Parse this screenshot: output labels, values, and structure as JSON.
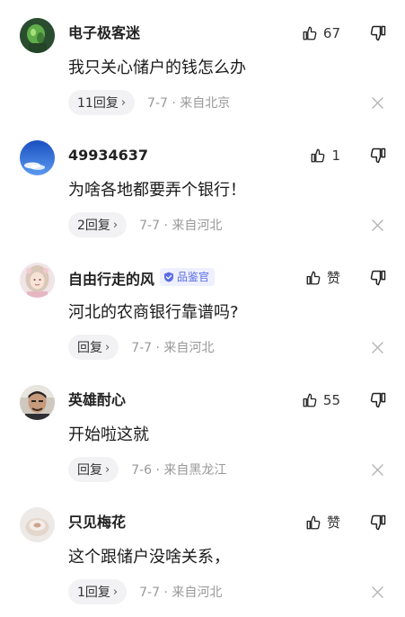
{
  "comments": [
    {
      "avatar_icon": "green-figure-avatar",
      "username": "电子极客迷",
      "badge": "",
      "like_icon": "thumbs-up-icon",
      "like_count": "67",
      "text": "我只关心储户的钱怎么办",
      "reply_label": "11回复",
      "chevron": "›",
      "meta": "7-7 · 来自北京"
    },
    {
      "avatar_icon": "blue-sky-avatar",
      "username": "49934637",
      "badge": "",
      "like_icon": "thumbs-up-icon",
      "like_count": "1",
      "text": "为啥各地都要弄个银行！",
      "reply_label": "2回复",
      "chevron": "›",
      "meta": "7-7 · 来自河北"
    },
    {
      "avatar_icon": "girl-portrait-avatar",
      "username": "自由行走的风",
      "badge": "品鉴官",
      "like_icon": "thumbs-up-icon",
      "like_count": "赞",
      "text": "河北的农商银行靠谱吗?",
      "reply_label": "回复",
      "chevron": "›",
      "meta": "7-7 · 来自河北"
    },
    {
      "avatar_icon": "man-portrait-avatar",
      "username": "英雄酎心",
      "badge": "",
      "like_icon": "thumbs-up-icon",
      "like_count": "55",
      "text": "开始啦这就",
      "reply_label": "回复",
      "chevron": "›",
      "meta": "7-6 · 来自黑龙江"
    },
    {
      "avatar_icon": "bowl-avatar",
      "username": "只见梅花",
      "badge": "",
      "like_icon": "thumbs-up-icon",
      "like_count": "赞",
      "text": "这个跟储户没啥关系，",
      "reply_label": "1回复",
      "chevron": "›",
      "meta": "7-7 · 来自河北"
    }
  ],
  "colors": {
    "text": "#1a1a1a",
    "meta": "#999999",
    "pill_bg": "#f2f2f4",
    "badge_bg": "#eef0ff",
    "badge_text": "#5b6de0"
  }
}
